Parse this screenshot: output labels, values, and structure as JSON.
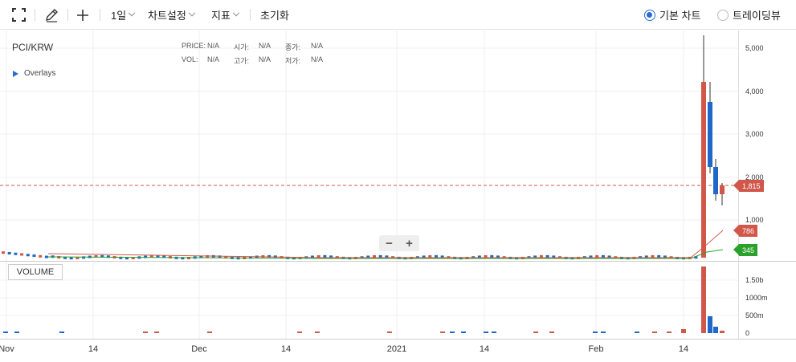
{
  "toolbar": {
    "interval": "1일",
    "chart_settings": "차트설정",
    "indicators": "지표",
    "reset": "초기화",
    "chart_mode_basic": "기본 차트",
    "chart_mode_tradingview": "트레이딩뷰",
    "selected_mode": "기본 차트"
  },
  "legend": {
    "symbol": "PCI/KRW",
    "price_label": "PRICE:",
    "price_value": "N/A",
    "open_label": "시가:",
    "open_value": "N/A",
    "close_label": "종가:",
    "close_value": "N/A",
    "vol_label": "VOL:",
    "vol_value": "N/A",
    "high_label": "고가:",
    "high_value": "N/A",
    "low_label": "저가:",
    "low_value": "N/A",
    "overlays": "Overlays"
  },
  "volume_label": "VOLUME",
  "zoom": {
    "minus": "−",
    "plus": "+"
  },
  "price_axis": [
    "5,000",
    "4,000",
    "3,000",
    "2,000",
    "1,000"
  ],
  "volume_axis": [
    "1.50b",
    "1000m",
    "500m",
    "0"
  ],
  "x_axis": [
    "Nov",
    "14",
    "Dec",
    "14",
    "2021",
    "14",
    "Feb",
    "14"
  ],
  "tags": {
    "current": "1,815",
    "ma_red": "786",
    "ma_green": "345"
  },
  "colors": {
    "up": "#d0574a",
    "down": "#1f68c9",
    "current_line": "#d0574a",
    "ma_red": "#d0574a",
    "ma_green": "#2ba12b",
    "accent": "#2a6cd6"
  }
}
